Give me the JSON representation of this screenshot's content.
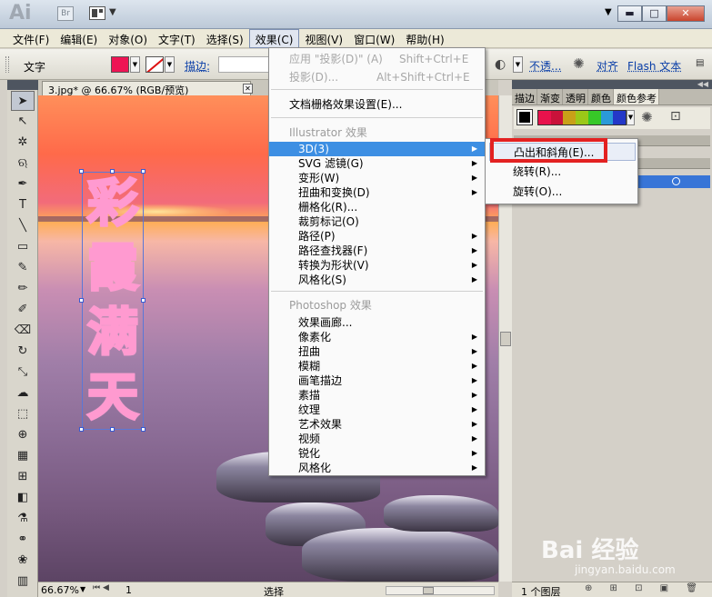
{
  "titlebar": {
    "logo": "Ai",
    "bridge": "Br",
    "win_min": "▬",
    "win_max": "□",
    "win_close": "✕"
  },
  "menubar": {
    "items": [
      "文件(F)",
      "编辑(E)",
      "对象(O)",
      "文字(T)",
      "选择(S)",
      "效果(C)",
      "视图(V)",
      "窗口(W)",
      "帮助(H)"
    ]
  },
  "controlbar": {
    "label": "文字",
    "fill_color": "#ee1454",
    "stroke_label": "描边:",
    "opacity_label": "不透...",
    "align_label": "对齐",
    "flash_label": "Flash 文本"
  },
  "document": {
    "tab_title": "3.jpg* @ 66.67% (RGB/预览)",
    "vertical_text": [
      "彩",
      "霞",
      "满",
      "天"
    ],
    "text_color": "#ec2a73"
  },
  "statusbar": {
    "zoom": "66.67%",
    "page": "1",
    "status": "选择"
  },
  "right_panel": {
    "tabs": [
      "描边",
      "渐变",
      "透明",
      "颜色",
      "颜色参考"
    ],
    "harmony_colors": [
      "#e8124c",
      "#c9123a",
      "#c9a018",
      "#9bc818",
      "#37c828",
      "#2a9ad8",
      "#2438c8"
    ],
    "layers_count": "1 个图层"
  },
  "effect_menu": {
    "apply_last": "应用 \"投影(D)\" (A)",
    "apply_last_shortcut": "Shift+Ctrl+E",
    "last_effect": "投影(D)...",
    "last_effect_shortcut": "Alt+Shift+Ctrl+E",
    "raster_settings": "文档栅格效果设置(E)...",
    "illustrator_header": "Illustrator 效果",
    "illustrator_items": [
      "3D(3)",
      "SVG 滤镜(G)",
      "变形(W)",
      "扭曲和变换(D)",
      "栅格化(R)...",
      "裁剪标记(O)",
      "路径(P)",
      "路径查找器(F)",
      "转换为形状(V)",
      "风格化(S)"
    ],
    "photoshop_header": "Photoshop 效果",
    "photoshop_items": [
      "效果画廊...",
      "像素化",
      "扭曲",
      "模糊",
      "画笔描边",
      "素描",
      "纹理",
      "艺术效果",
      "视频",
      "锐化",
      "风格化"
    ]
  },
  "submenu_3d": {
    "items": [
      "凸出和斜角(E)...",
      "绕转(R)...",
      "旋转(O)..."
    ]
  },
  "watermark": {
    "brand": "Bai 经验",
    "url": "jingyan.baidu.com"
  }
}
